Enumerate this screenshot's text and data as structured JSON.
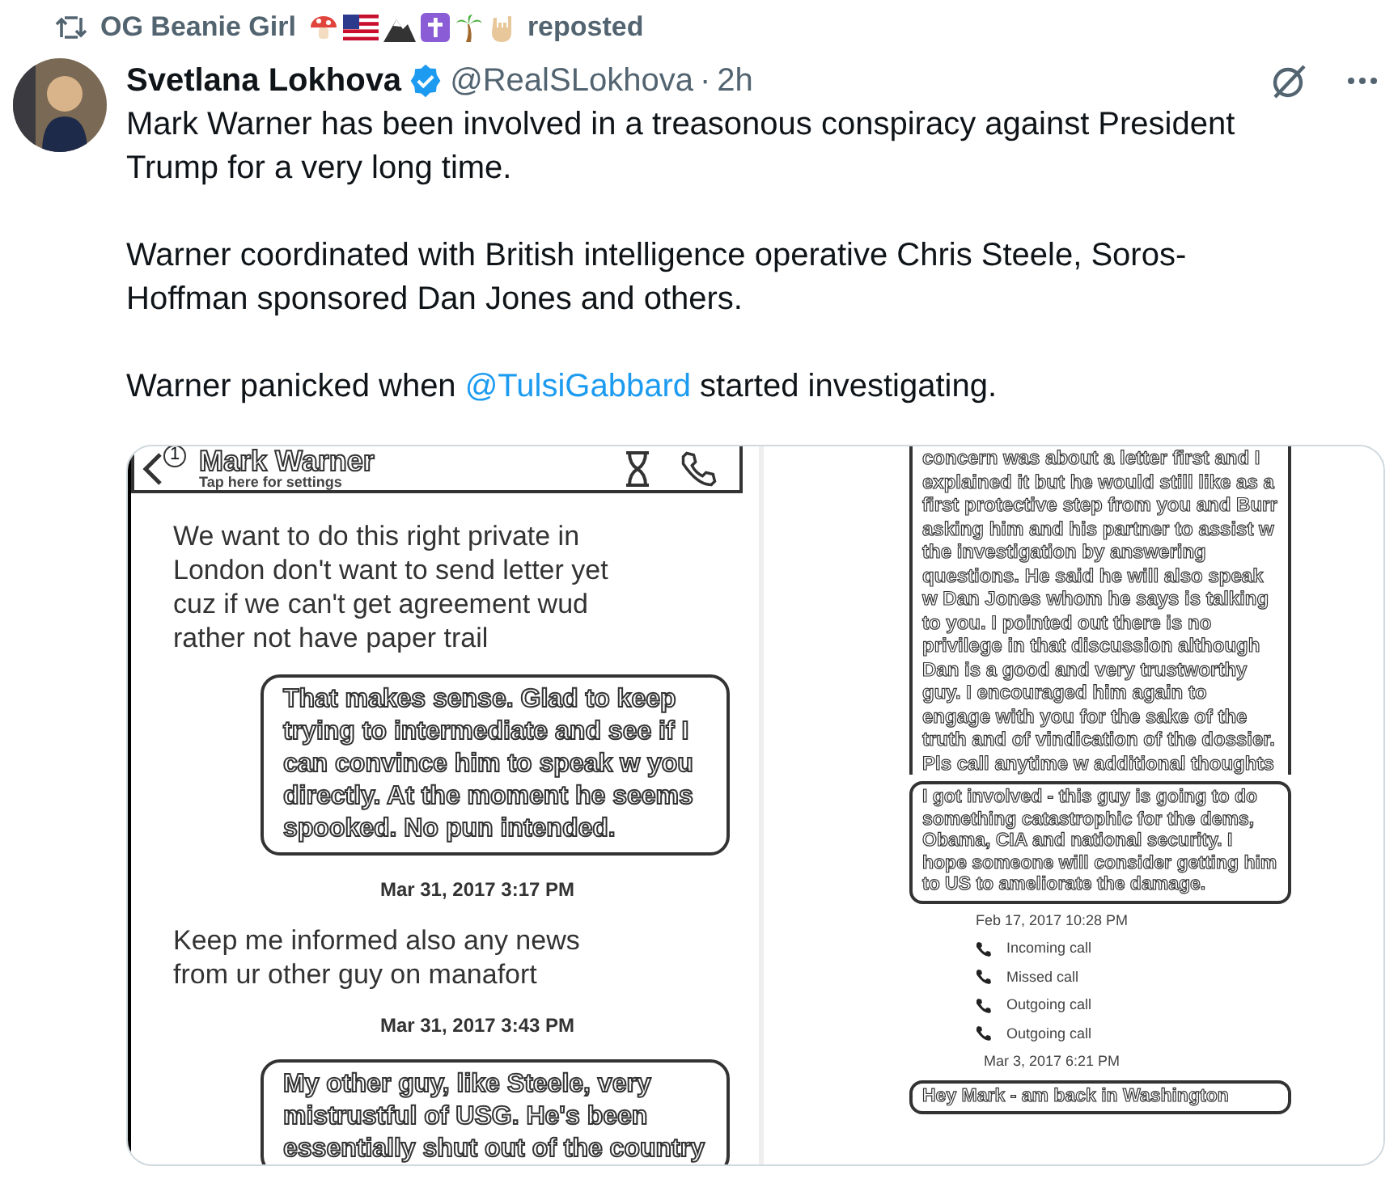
{
  "repost": {
    "user": "OG Beanie Girl",
    "label": "reposted"
  },
  "post": {
    "name": "Svetlana Lokhova",
    "verified": true,
    "handle": "@RealSLokhova",
    "separator": "·",
    "time": "2h",
    "paragraphs": [
      [
        {
          "kind": "text",
          "text": "Mark Warner has been involved in a treasonous conspiracy against President Trump for a very long time."
        }
      ],
      [
        {
          "kind": "text",
          "text": "Warner coordinated with British intelligence operative Chris Steele, Soros-Hoffman sponsored Dan Jones and others."
        }
      ],
      [
        {
          "kind": "text",
          "text": "Warner panicked when "
        },
        {
          "kind": "mention",
          "text": "@TulsiGabbard"
        },
        {
          "kind": "text",
          "text": " started investigating."
        }
      ]
    ]
  },
  "media": {
    "left": {
      "contact": "Mark Warner",
      "subtitle": "Tap here for settings",
      "badge": "1",
      "messages": [
        {
          "kind": "received",
          "text": "We want to do this right private in London don't want to send letter yet cuz if we can't get agreement wud rather not have paper trail"
        },
        {
          "kind": "sent",
          "text": "That makes sense. Glad to keep trying to intermediate and see if I can convince him to speak w you directly. At the moment he seems spooked. No pun intended."
        },
        {
          "kind": "timestamp",
          "text": "Mar 31, 2017 3:17 PM"
        },
        {
          "kind": "received",
          "text": "Keep me informed also any news from ur other guy on manafort"
        },
        {
          "kind": "timestamp",
          "text": "Mar 31, 2017 3:43 PM"
        },
        {
          "kind": "sent",
          "text": "My other guy, like Steele, very mistrustful of USG. He's been essentially shut out of the country"
        }
      ]
    },
    "right": {
      "page_text": "concern was about a letter first and I explained it but he would still like as a first protective step from you and Burr asking him and his partner to assist w the investigation by answering questions. He said he will also speak w Dan Jones whom he says is talking to you. I pointed out there is no privilege in that discussion although Dan is a good and very trustworthy guy. I encouraged him again to engage with you for the sake of the truth and of vindication of the dossier. Pls call anytime w additional thoughts",
      "messages": [
        {
          "kind": "sent",
          "text": "I got involved - this guy is going to do something catastrophic for the dems, Obama, CIA and national security. I hope someone will consider getting him to US to ameliorate the damage."
        },
        {
          "kind": "timestamp",
          "text": "Feb 17, 2017 10:28 PM"
        },
        {
          "kind": "call",
          "text": "Incoming call"
        },
        {
          "kind": "call",
          "text": "Missed call"
        },
        {
          "kind": "call",
          "text": "Outgoing call"
        },
        {
          "kind": "call",
          "text": "Outgoing call"
        },
        {
          "kind": "timestamp",
          "text": "Mar 3, 2017 6:21 PM"
        },
        {
          "kind": "sent",
          "text": "Hey Mark - am back in Washington"
        }
      ]
    }
  }
}
